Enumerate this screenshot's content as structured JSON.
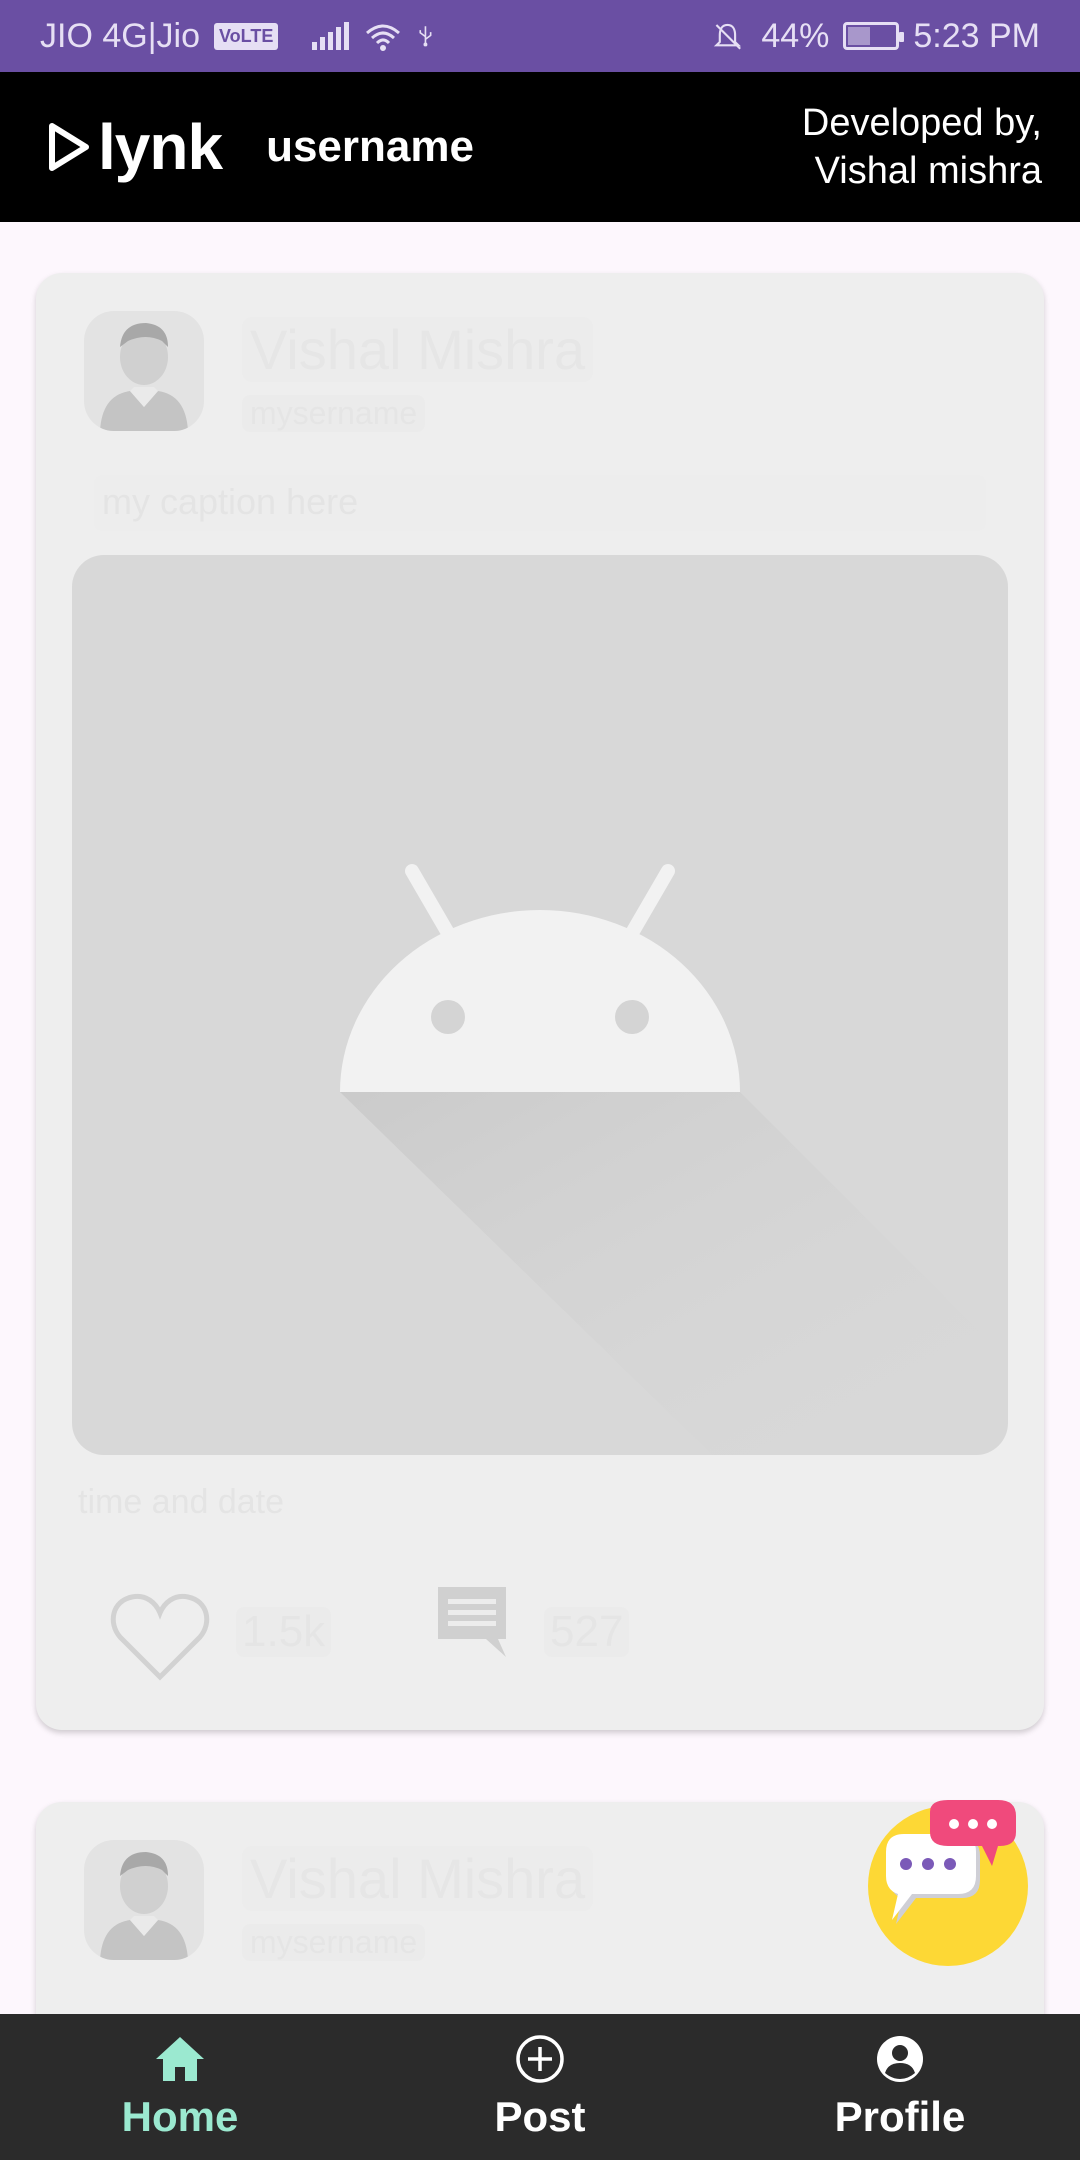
{
  "status_bar": {
    "carrier": "JIO 4G|Jio",
    "volte": "VoLTE",
    "battery_percent": "44%",
    "time": "5:23 PM"
  },
  "app_bar": {
    "logo_text": "lynk",
    "username": "username",
    "developed_by_line1": "Developed by,",
    "developed_by_line2": "Vishal mishra"
  },
  "posts": [
    {
      "name": "Vishal Mishra",
      "handle": "mysername",
      "caption": "my caption here",
      "meta": "time and date",
      "likes": "1.5k",
      "comments": "527"
    },
    {
      "name": "Vishal Mishra",
      "handle": "mysername"
    }
  ],
  "bottom_nav": {
    "items": [
      {
        "label": "Home",
        "icon": "home-icon",
        "active": true
      },
      {
        "label": "Post",
        "icon": "add-circle-icon",
        "active": false
      },
      {
        "label": "Profile",
        "icon": "account-circle-icon",
        "active": false
      }
    ]
  },
  "colors": {
    "status_bar": "#6a4fa3",
    "app_bar": "#000000",
    "bottom_nav": "#2b2b2b",
    "active_nav": "#9be9d0",
    "card": "#eeeeee",
    "fab_yellow": "#fdd835",
    "fab_pink": "#f04a7c"
  }
}
